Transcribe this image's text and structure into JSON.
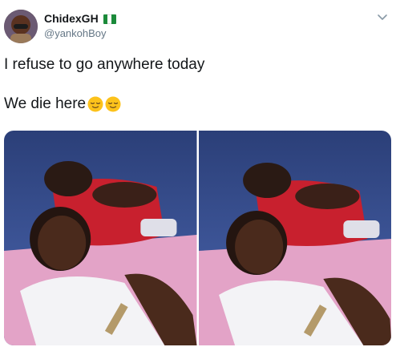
{
  "tweet": {
    "display_name": "ChidexGH",
    "handle": "@yankohBoy",
    "text_line1": "I refuse to go anywhere today",
    "text_line2": "We die here",
    "flag": "nigeria-flag",
    "media_count": 2,
    "colors": {
      "text": "#14171a",
      "secondary": "#657786",
      "flag_green": "#1b8a3a"
    }
  }
}
